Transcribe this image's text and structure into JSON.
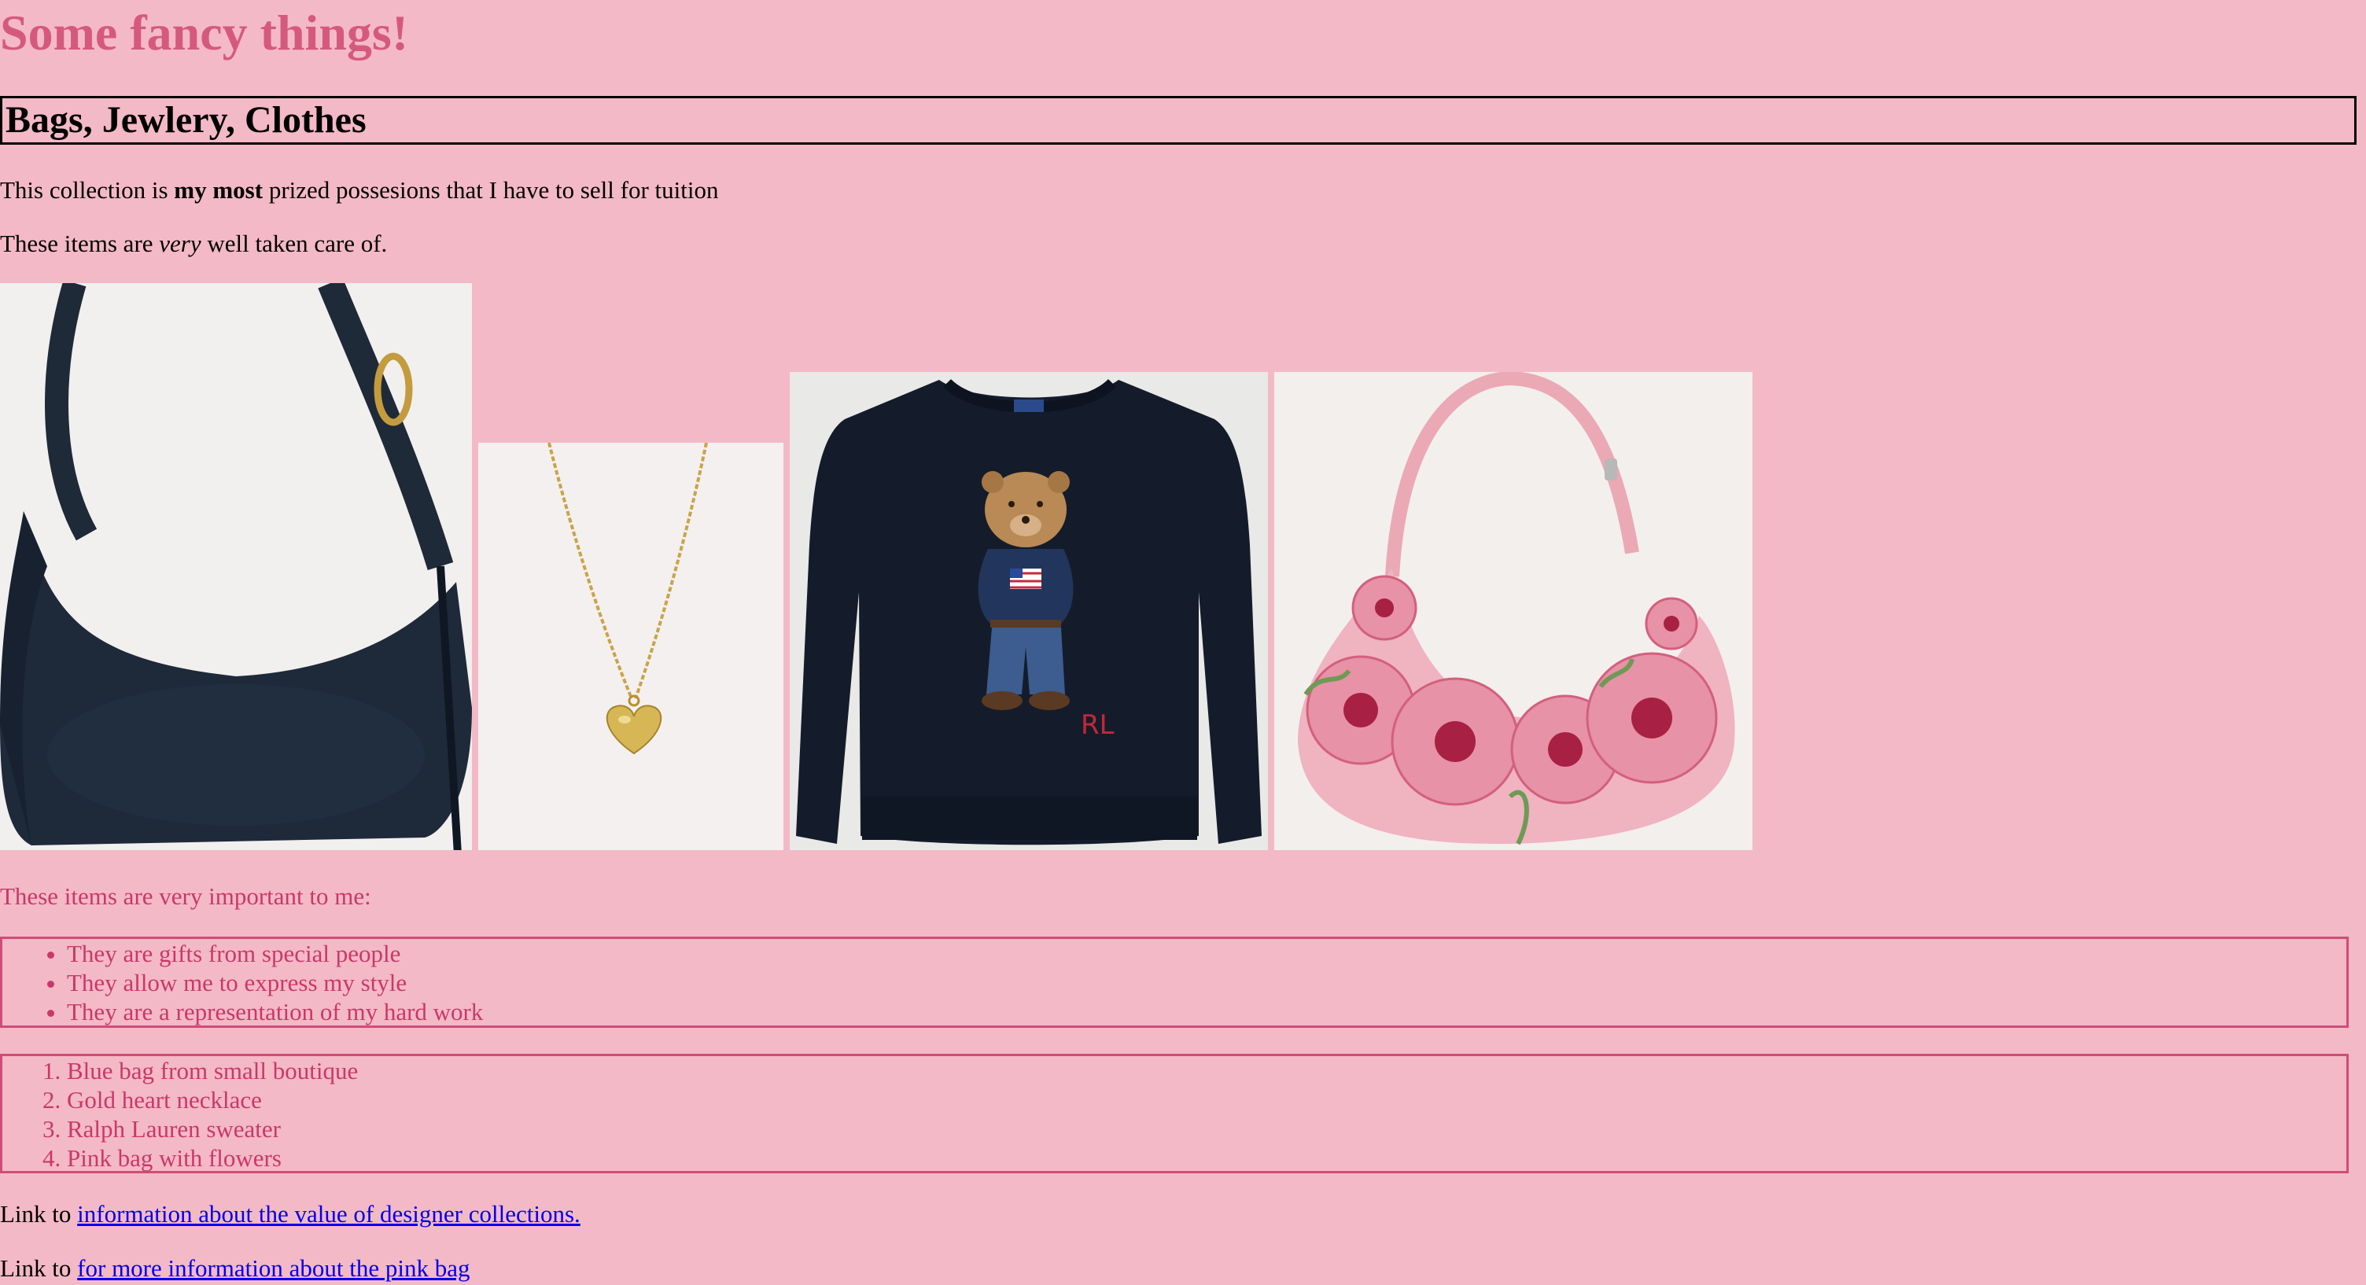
{
  "page": {
    "title": "Some fancy things!",
    "subtitle": "Bags, Jewlery, Clothes",
    "intro": {
      "before": "This collection is ",
      "bold": "my most",
      "after": " prized possesions that I have to sell for tuition"
    },
    "care": {
      "before": "These items are ",
      "italic": "very",
      "after": " well taken care of."
    },
    "important_heading": "These items are very important to me:",
    "reasons": [
      "They are gifts from special people",
      "They allow me to express my style",
      "They are a representation of my hard work"
    ],
    "items": [
      "Blue bag from small boutique",
      "Gold heart necklace",
      "Ralph Lauren sweater",
      "Pink bag with flowers"
    ],
    "links": [
      {
        "prefix": "Link to ",
        "text": "information about the value of designer collections."
      },
      {
        "prefix": "Link to ",
        "text": "for more information about the pink bag"
      }
    ]
  },
  "images": {
    "sweater_logo_text": "RL"
  },
  "colors": {
    "background": "#f4b9c6",
    "title": "#d5597f",
    "pink_text": "#c9386a",
    "box_border": "#d04c78",
    "link": "#0000ee"
  }
}
